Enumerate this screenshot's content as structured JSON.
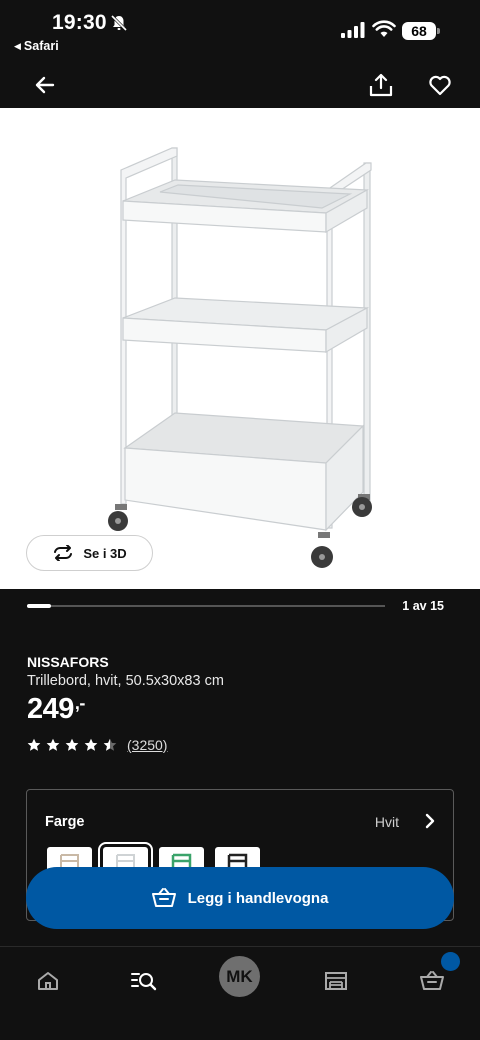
{
  "status_bar": {
    "time": "19:30",
    "back_app": "Safari",
    "battery": "68"
  },
  "header": {
    "back_icon": "arrow-left-icon",
    "share_icon": "share-icon",
    "favorite_icon": "heart-icon"
  },
  "gallery": {
    "view_3d_label": "Se i 3D",
    "position": "1 av 15",
    "current_index": 1,
    "total": 15
  },
  "product": {
    "name": "NISSAFORS",
    "description": "Trillebord, hvit, 50.5x30x83 cm",
    "price": "249",
    "price_suffix": ",-",
    "rating": 4.5,
    "rating_max": 5,
    "review_count": "(3250)"
  },
  "color_selector": {
    "label": "Farge",
    "selected_value": "Hvit",
    "swatches": [
      "beige",
      "white",
      "green",
      "black"
    ],
    "selected_index": 1
  },
  "add_to_cart": {
    "label": "Legg i handlevogna",
    "icon": "shopping-basket-icon"
  },
  "bottom_nav": {
    "items": [
      "home-icon",
      "search-list-icon",
      "profile-avatar",
      "store-icon",
      "basket-icon"
    ],
    "avatar_initials": "MK"
  },
  "colors": {
    "brand_blue": "#0058a3",
    "background": "#111111"
  }
}
